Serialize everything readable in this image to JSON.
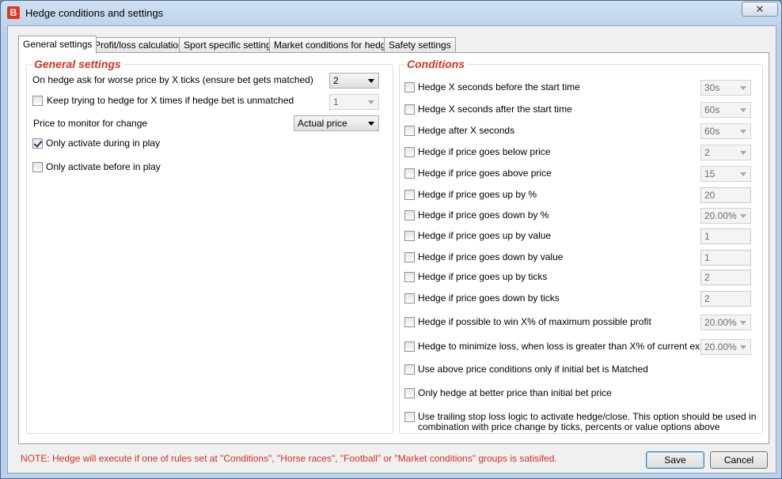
{
  "window": {
    "title": "Hedge conditions and settings",
    "app_icon": "B",
    "close_glyph": "✕"
  },
  "tabs": [
    {
      "label": "General settings",
      "active": true
    },
    {
      "label": "Profit/loss calculation",
      "active": false
    },
    {
      "label": "Sport specific settings",
      "active": false
    },
    {
      "label": "Market conditions for hedge",
      "active": false
    },
    {
      "label": "Safety settings",
      "active": false
    }
  ],
  "general": {
    "title": "General settings",
    "worse_price_label": "On hedge ask for worse price by X ticks (ensure bet gets matched)",
    "worse_price_value": "2",
    "keep_trying_label": "Keep trying to hedge for X times if hedge bet is unmatched",
    "keep_trying_checked": false,
    "keep_trying_value": "1",
    "price_monitor_label": "Price to monitor for change",
    "price_monitor_value": "Actual price",
    "in_play_label": "Only activate during in play",
    "in_play_checked": true,
    "before_play_label": "Only activate before in play",
    "before_play_checked": false
  },
  "conditions": {
    "title": "Conditions",
    "rows": [
      {
        "label": "Hedge X seconds before the start time",
        "checked": false,
        "value": "30s",
        "control": "combo"
      },
      {
        "label": "Hedge X seconds after the start time",
        "checked": false,
        "value": "60s",
        "control": "combo"
      },
      {
        "label": "Hedge after X seconds",
        "checked": false,
        "value": "60s",
        "control": "combo"
      },
      {
        "label": "Hedge if price goes below price",
        "checked": false,
        "value": "2",
        "control": "combo"
      },
      {
        "label": "Hedge if price goes above price",
        "checked": false,
        "value": "15",
        "control": "combo"
      },
      {
        "label": "Hedge if price goes up by %",
        "checked": false,
        "value": "20",
        "control": "text"
      },
      {
        "label": "Hedge if price goes down by %",
        "checked": false,
        "value": "20.00%",
        "control": "combo"
      },
      {
        "label": "Hedge if price goes up by value",
        "checked": false,
        "value": "1",
        "control": "text"
      },
      {
        "label": "Hedge if price goes down by value",
        "checked": false,
        "value": "1",
        "control": "text"
      },
      {
        "label": "Hedge if price goes up by ticks",
        "checked": false,
        "value": "2",
        "control": "text"
      },
      {
        "label": "Hedge if price goes down by ticks",
        "checked": false,
        "value": "2",
        "control": "text"
      },
      {
        "label": "Hedge if possible to win X% of maximum possible profit",
        "checked": false,
        "value": "20.00%",
        "control": "combo"
      },
      {
        "label": "Hedge to minimize loss, when loss is greater than X% of current exposure",
        "checked": false,
        "value": "20.00%",
        "control": "combo"
      },
      {
        "label": "Use above price conditions only if initial bet is Matched",
        "checked": false,
        "value": "",
        "control": "none"
      },
      {
        "label": "Only hedge at better price than initial bet price",
        "checked": false,
        "value": "",
        "control": "none"
      },
      {
        "label": "Use trailing stop loss logic to activate hedge/close. This option should be used in",
        "label2": "combination with price change by ticks, percents or value options above",
        "checked": false,
        "value": "",
        "control": "none"
      }
    ]
  },
  "footer": {
    "note": "NOTE: Hedge will execute if one of rules set at \"Conditions\", \"Horse races\", \"Football\" or \"Market conditions\" groups is satisifed.",
    "save_label": "Save",
    "cancel_label": "Cancel"
  }
}
